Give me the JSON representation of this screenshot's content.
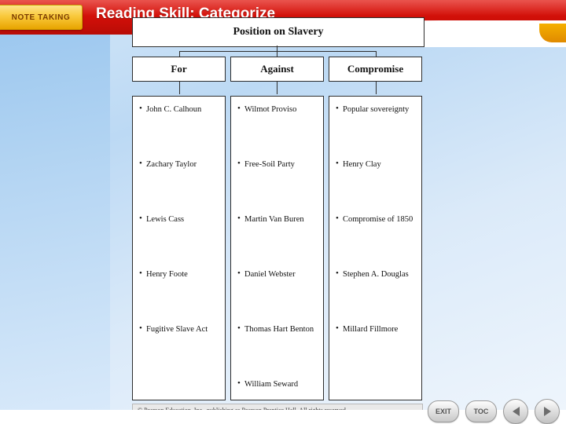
{
  "header": {
    "tag_label": "NOTE TAKING",
    "title": "Reading Skill: Categorize"
  },
  "diagram": {
    "title": "Position on Slavery",
    "columns": [
      {
        "heading": "For",
        "items": [
          "John C. Calhoun",
          "Zachary Taylor",
          "Lewis Cass",
          "Henry Foote",
          "Fugitive Slave Act"
        ]
      },
      {
        "heading": "Against",
        "items": [
          "Wilmot Proviso",
          "Free-Soil Party",
          "Martin Van Buren",
          "Daniel Webster",
          "Thomas Hart Benton",
          "William Seward"
        ]
      },
      {
        "heading": "Compromise",
        "items": [
          "Popular sovereignty",
          "Henry Clay",
          "Compromise of 1850",
          "Stephen A. Douglas",
          "Millard Fillmore"
        ]
      }
    ],
    "credit": "© Pearson Education, Inc., publishing as Pearson Prentice Hall. All rights reserved."
  },
  "nav": {
    "exit_label": "EXIT",
    "toc_label": "TOC",
    "prev_icon": "chevron-left-icon",
    "next_icon": "chevron-right-icon"
  },
  "colors": {
    "header_red": "#cf0f08",
    "tag_yellow": "#f9c93c",
    "background_blue": "#bcd9f4"
  }
}
